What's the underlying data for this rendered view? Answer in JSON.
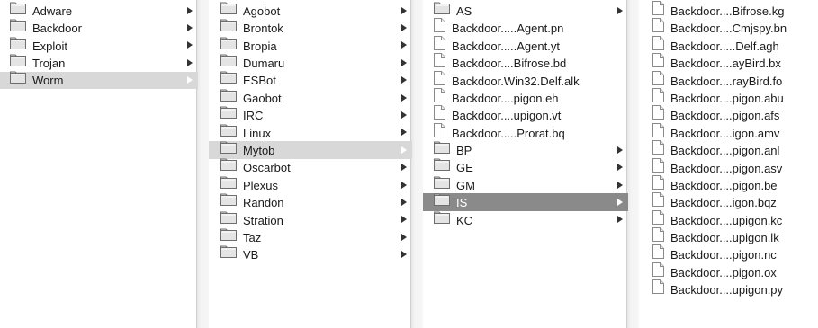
{
  "columns": [
    {
      "items": [
        {
          "label": "Adware",
          "type": "folder"
        },
        {
          "label": "Backdoor",
          "type": "folder"
        },
        {
          "label": "Exploit",
          "type": "folder"
        },
        {
          "label": "Trojan",
          "type": "folder"
        },
        {
          "label": "Worm",
          "type": "folder",
          "selected": "light"
        }
      ]
    },
    {
      "items": [
        {
          "label": "Agobot",
          "type": "folder"
        },
        {
          "label": "Brontok",
          "type": "folder"
        },
        {
          "label": "Bropia",
          "type": "folder"
        },
        {
          "label": "Dumaru",
          "type": "folder"
        },
        {
          "label": "ESBot",
          "type": "folder"
        },
        {
          "label": "Gaobot",
          "type": "folder"
        },
        {
          "label": "IRC",
          "type": "folder"
        },
        {
          "label": "Linux",
          "type": "folder"
        },
        {
          "label": "Mytob",
          "type": "folder",
          "selected": "light"
        },
        {
          "label": "Oscarbot",
          "type": "folder"
        },
        {
          "label": "Plexus",
          "type": "folder"
        },
        {
          "label": "Randon",
          "type": "folder"
        },
        {
          "label": "Stration",
          "type": "folder"
        },
        {
          "label": "Taz",
          "type": "folder"
        },
        {
          "label": "VB",
          "type": "folder"
        }
      ]
    },
    {
      "items": [
        {
          "label": "AS",
          "type": "folder"
        },
        {
          "label": "Backdoor.....Agent.pn",
          "type": "file"
        },
        {
          "label": "Backdoor.....Agent.yt",
          "type": "file"
        },
        {
          "label": "Backdoor....Bifrose.bd",
          "type": "file"
        },
        {
          "label": "Backdoor.Win32.Delf.alk",
          "type": "file"
        },
        {
          "label": "Backdoor....pigon.eh",
          "type": "file"
        },
        {
          "label": "Backdoor....upigon.vt",
          "type": "file"
        },
        {
          "label": "Backdoor.....Prorat.bq",
          "type": "file"
        },
        {
          "label": "BP",
          "type": "folder"
        },
        {
          "label": "GE",
          "type": "folder"
        },
        {
          "label": "GM",
          "type": "folder"
        },
        {
          "label": "IS",
          "type": "folder",
          "selected": "dark"
        },
        {
          "label": "KC",
          "type": "folder"
        }
      ]
    },
    {
      "items": [
        {
          "label": "Backdoor....Bifrose.kg",
          "type": "file"
        },
        {
          "label": "Backdoor....Cmjspy.bn",
          "type": "file"
        },
        {
          "label": "Backdoor.....Delf.agh",
          "type": "file"
        },
        {
          "label": "Backdoor....ayBird.bx",
          "type": "file"
        },
        {
          "label": "Backdoor....rayBird.fo",
          "type": "file"
        },
        {
          "label": "Backdoor....pigon.abu",
          "type": "file"
        },
        {
          "label": "Backdoor....pigon.afs",
          "type": "file"
        },
        {
          "label": "Backdoor....igon.amv",
          "type": "file"
        },
        {
          "label": "Backdoor....pigon.anl",
          "type": "file"
        },
        {
          "label": "Backdoor....pigon.asv",
          "type": "file"
        },
        {
          "label": "Backdoor....pigon.be",
          "type": "file"
        },
        {
          "label": "Backdoor....igon.bqz",
          "type": "file"
        },
        {
          "label": "Backdoor....upigon.kc",
          "type": "file"
        },
        {
          "label": "Backdoor....upigon.lk",
          "type": "file"
        },
        {
          "label": "Backdoor....pigon.nc",
          "type": "file"
        },
        {
          "label": "Backdoor....pigon.ox",
          "type": "file"
        },
        {
          "label": "Backdoor....upigon.py",
          "type": "file"
        }
      ]
    }
  ],
  "colors": {
    "selected_light": "#d8d8d8",
    "selected_dark": "#8a8a8a",
    "folder_fill": "#e4e4e4",
    "folder_stroke": "#6e6e6e"
  }
}
